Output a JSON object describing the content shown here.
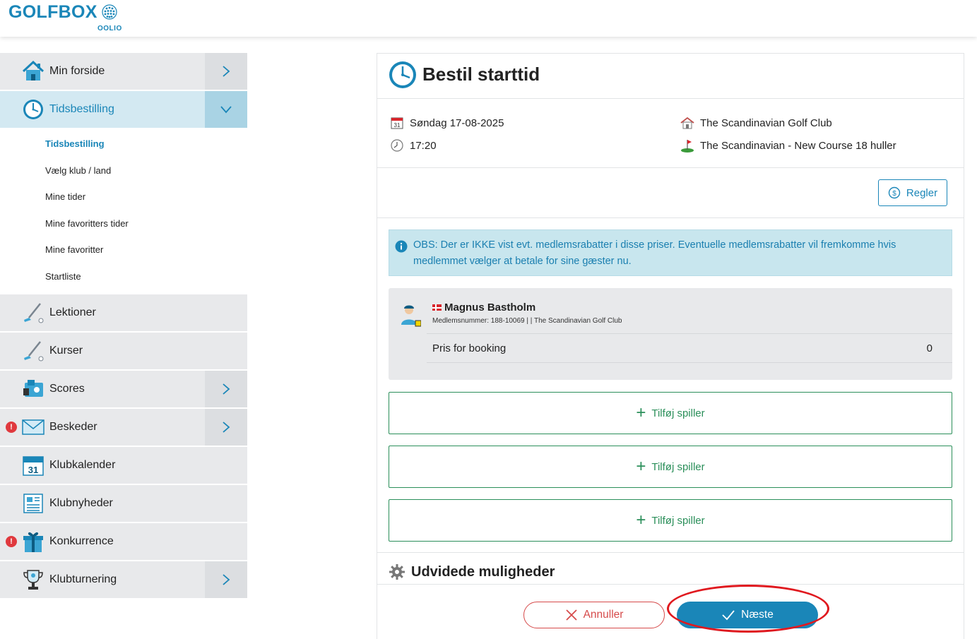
{
  "header": {
    "logo_text": "GOLFBOX",
    "logo_sub": "OOLIO"
  },
  "sidebar": {
    "items": [
      {
        "label": "Min forside",
        "icon": "home-icon",
        "chevron": "right"
      },
      {
        "label": "Tidsbestilling",
        "icon": "clock-icon",
        "chevron": "down",
        "active": true
      },
      {
        "label": "Lektioner",
        "icon": "golf-club-icon"
      },
      {
        "label": "Kurser",
        "icon": "golf-club-icon"
      },
      {
        "label": "Scores",
        "icon": "scorecard-icon",
        "chevron": "right"
      },
      {
        "label": "Beskeder",
        "icon": "envelope-icon",
        "chevron": "right",
        "alert": "!"
      },
      {
        "label": "Klubkalender",
        "icon": "calendar-icon",
        "calendar_day": "31"
      },
      {
        "label": "Klubnyheder",
        "icon": "newspaper-icon"
      },
      {
        "label": "Konkurrence",
        "icon": "gift-icon",
        "alert": "!"
      },
      {
        "label": "Klubturnering",
        "icon": "trophy-icon",
        "chevron": "right"
      }
    ],
    "submenu": [
      {
        "label": "Tidsbestilling",
        "active": true
      },
      {
        "label": "Vælg klub / land"
      },
      {
        "label": "Mine tider"
      },
      {
        "label": "Mine favoritters tider"
      },
      {
        "label": "Mine favoritter"
      },
      {
        "label": "Startliste"
      }
    ]
  },
  "booking": {
    "title": "Bestil starttid",
    "date": "Søndag 17-08-2025",
    "time": "17:20",
    "club": "The Scandinavian Golf Club",
    "course": "The Scandinavian - New Course 18 huller",
    "calendar_day": "31",
    "rules_button": "Regler",
    "notice": "OBS: Der er IKKE vist evt. medlemsrabatter i disse priser. Eventuelle medlemsrabatter vil fremkomme hvis medlemmet vælger at betale for sine gæster nu.",
    "player": {
      "name": "Magnus Bastholm",
      "meta": "Medlemsnummer: 188-10069 |  | The Scandinavian Golf Club",
      "price_label": "Pris for booking",
      "price_value": "0"
    },
    "add_player_label": "Tilføj spiller",
    "extended_options": "Udvidede muligheder",
    "cancel_button": "Annuller",
    "next_button": "Næste"
  },
  "colors": {
    "brand": "#1a86b8",
    "green": "#2b8f5a",
    "danger": "#d64b4b",
    "alert": "#e0393e"
  }
}
